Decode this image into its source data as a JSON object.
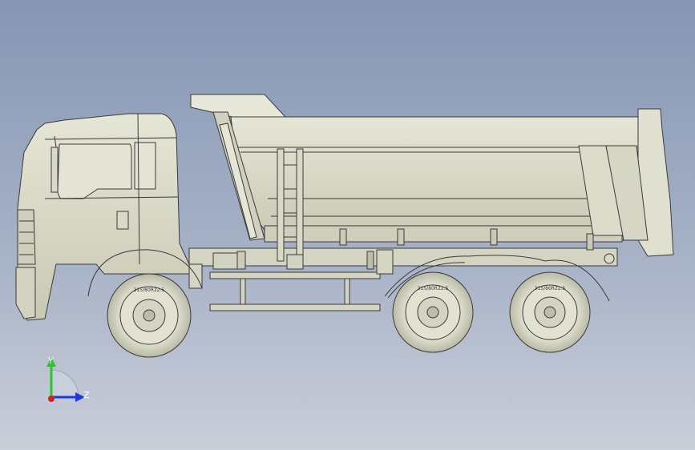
{
  "viewport": {
    "background_top": "#8596b4",
    "background_bottom": "#c9ced9",
    "model_fill": "#d9d9c8",
    "model_stroke": "#3a3a3a"
  },
  "triad": {
    "y_label": "Y",
    "z_label": "Z",
    "y_color": "#2fc42f",
    "z_color": "#1f3bd6",
    "x_color": "#d12020"
  },
  "tires": {
    "front_text": "315/80R22.5",
    "rear1_text": "315/80R22.5",
    "rear2_text": "315/80R22.5"
  }
}
